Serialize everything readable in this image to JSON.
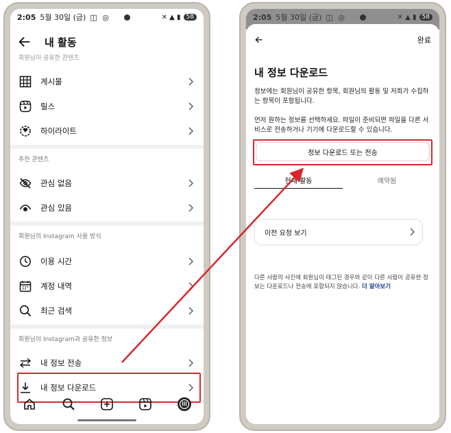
{
  "left": {
    "status": {
      "time": "2:05",
      "date": "5월 30일 (금)",
      "battery": "58"
    },
    "header": {
      "title": "내 활동"
    },
    "cut_section_label": "회원님이 공유한 콘텐츠",
    "items_shared": [
      {
        "label": "게시물",
        "icon": "grid-icon"
      },
      {
        "label": "릴스",
        "icon": "reels-icon"
      },
      {
        "label": "하이라이트",
        "icon": "highlight-icon"
      }
    ],
    "section_recommended": "추천 콘텐츠",
    "items_recommended": [
      {
        "label": "관심 없음",
        "icon": "eye-off-icon"
      },
      {
        "label": "관심 있음",
        "icon": "eye-icon"
      }
    ],
    "section_usage": "회원님의 Instagram 사용 방식",
    "items_usage": [
      {
        "label": "이용 시간",
        "icon": "clock-icon"
      },
      {
        "label": "계정 내역",
        "icon": "calendar-icon"
      },
      {
        "label": "최근 검색",
        "icon": "search-icon"
      }
    ],
    "section_info": "회원님이 Instagram과 공유한 정보",
    "items_info": [
      {
        "label": "내 정보 전송",
        "icon": "transfer-icon"
      },
      {
        "label": "내 정보 다운로드",
        "icon": "download-icon"
      }
    ]
  },
  "right": {
    "status": {
      "time": "2:05",
      "date": "5월 30일 (금)",
      "battery": "58"
    },
    "done_label": "완료",
    "title": "내 정보 다운로드",
    "para1": "정보에는 회원님이 공유한 항목, 회원님의 활동 및 저희가 수집하는 항목이 포함됩니다.",
    "para2": "먼저 원하는 정보를 선택하세요. 파일이 준비되면 파일을 다른 서비스로 전송하거나 기기에 다운로드할 수 있습니다.",
    "download_button": "정보 다운로드 또는 전송",
    "tabs": [
      "현재 활동",
      "예약됨"
    ],
    "prev_requests": "이전 요청 보기",
    "footer": "다른 사람의 사진에 회원님이 태그된 경우와 같이 다른 사람이 공유한 정보는 다운로드나 전송에 포함되지 않습니다.",
    "learn_more": "더 알아보기"
  },
  "colors": {
    "highlight": "#d8262c",
    "link": "#1a3b8f"
  }
}
